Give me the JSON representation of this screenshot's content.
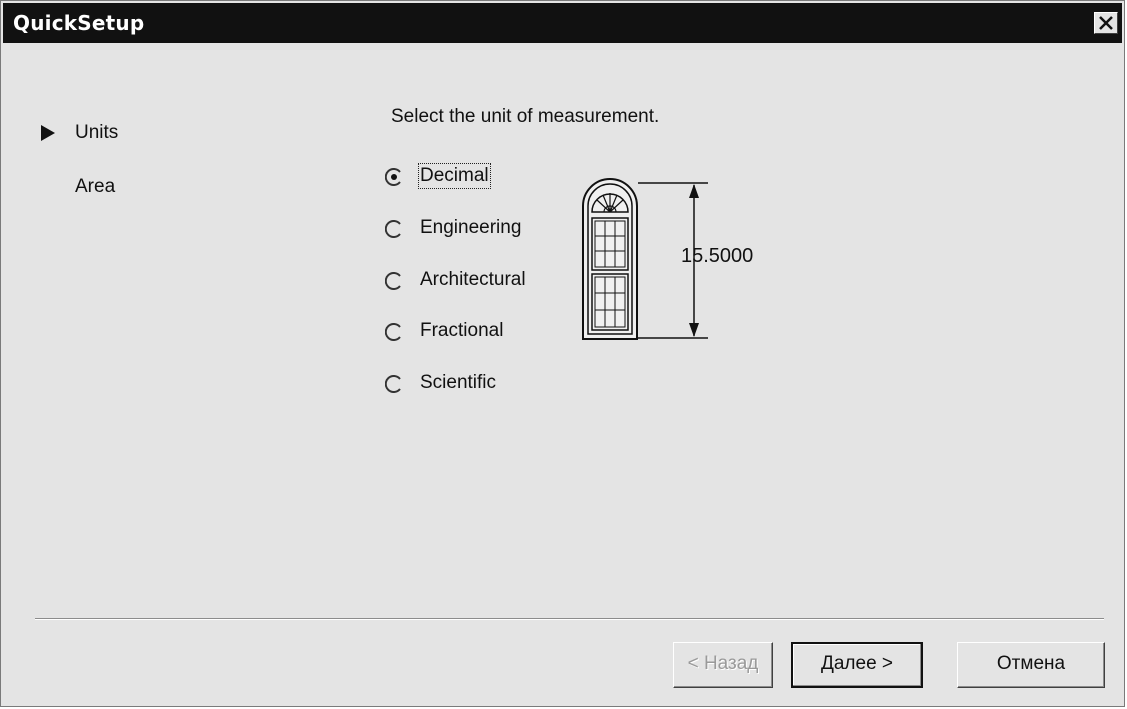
{
  "window": {
    "title": "QuickSetup",
    "close_symbol": "×"
  },
  "nav": {
    "items": [
      {
        "label": "Units",
        "selected": true
      },
      {
        "label": "Area",
        "selected": false
      }
    ]
  },
  "units": {
    "prompt": "Select the unit of measurement.",
    "options": [
      {
        "label": "Decimal",
        "selected": true
      },
      {
        "label": "Engineering",
        "selected": false
      },
      {
        "label": "Architectural",
        "selected": false
      },
      {
        "label": "Fractional",
        "selected": false
      },
      {
        "label": "Scientific",
        "selected": false
      }
    ],
    "sample_value": "15.5000"
  },
  "buttons": {
    "back_label": "< Назад",
    "next_label": "Далее >",
    "cancel_label": "Отмена"
  },
  "icons": {
    "close": "close-icon",
    "nav_pointer": "triangle-right-icon",
    "preview": "window-illustration-icon"
  }
}
